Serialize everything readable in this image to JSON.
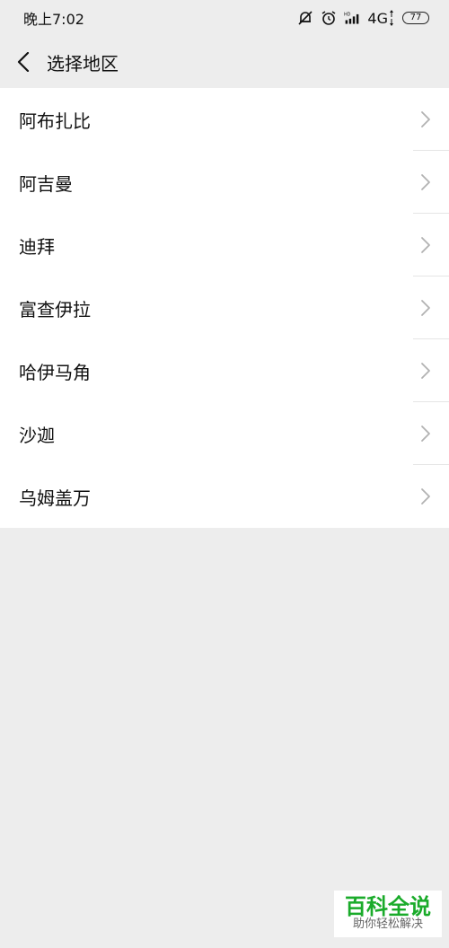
{
  "status_bar": {
    "time": "晚上7:02",
    "network": "4G",
    "battery": "77",
    "icons": [
      "notifications-off-icon",
      "alarm-icon",
      "hd-signal-icon",
      "network-up-down-icon",
      "battery-icon"
    ]
  },
  "header": {
    "title": "选择地区",
    "back_icon": "chevron-left-icon"
  },
  "regions": [
    {
      "label": "阿布扎比"
    },
    {
      "label": "阿吉曼"
    },
    {
      "label": "迪拜"
    },
    {
      "label": "富查伊拉"
    },
    {
      "label": "哈伊马角"
    },
    {
      "label": "沙迦"
    },
    {
      "label": "乌姆盖万"
    }
  ],
  "watermark": {
    "title": "百科全说",
    "subtitle": "助你轻松解决"
  }
}
